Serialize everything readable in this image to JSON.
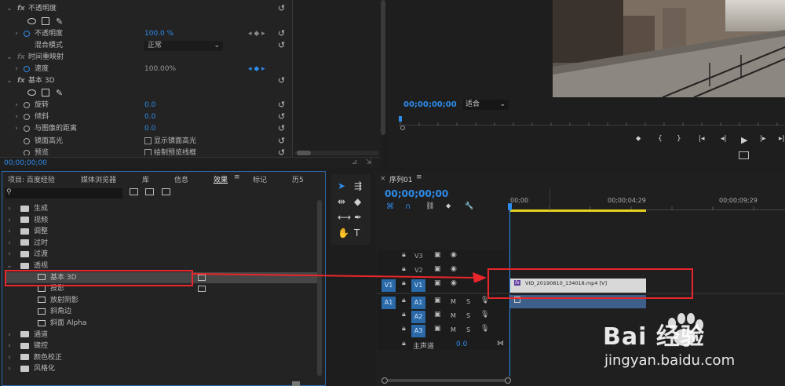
{
  "effect_controls": {
    "opacity_section": "不透明度",
    "opacity_label": "不透明度",
    "opacity_value": "100.0 %",
    "blend_label": "混合模式",
    "blend_value": "正常",
    "time_remap_section": "时间重映射",
    "speed_label": "速度",
    "speed_value": "100.00%",
    "basic3d_section": "基本 3D",
    "swivel_label": "旋转",
    "swivel_value": "0.0",
    "tilt_label": "倾斜",
    "tilt_value": "0.0",
    "distance_label": "与图像的距离",
    "distance_value": "0.0",
    "specular_label": "镜面高光",
    "specular_checkbox": "显示镜面高光",
    "preview_label": "预览",
    "preview_checkbox": "绘制预览线框",
    "timecode": "00;00;00;00",
    "fx_glyph": "fx"
  },
  "program_monitor": {
    "timecode": "00;00;00;00",
    "fit_value": "适合"
  },
  "project_panel": {
    "tabs": [
      "项目: 百度经验",
      "媒体浏览器",
      "库",
      "信息",
      "效果",
      "标记",
      "历5"
    ],
    "active_tab": "效果",
    "search_placeholder": "",
    "tree": [
      {
        "label": "生成",
        "type": "folder",
        "expanded": false
      },
      {
        "label": "视频",
        "type": "folder",
        "expanded": false
      },
      {
        "label": "调整",
        "type": "folder",
        "expanded": false
      },
      {
        "label": "过时",
        "type": "folder",
        "expanded": false
      },
      {
        "label": "过渡",
        "type": "folder",
        "expanded": false
      },
      {
        "label": "透视",
        "type": "folder",
        "expanded": true
      },
      {
        "label": "基本 3D",
        "type": "effect",
        "selected": true
      },
      {
        "label": "投影",
        "type": "effect"
      },
      {
        "label": "放射阴影",
        "type": "effect"
      },
      {
        "label": "斜角边",
        "type": "effect"
      },
      {
        "label": "斜面 Alpha",
        "type": "effect"
      },
      {
        "label": "通道",
        "type": "folder",
        "expanded": false
      },
      {
        "label": "键控",
        "type": "folder",
        "expanded": false
      },
      {
        "label": "颜色校正",
        "type": "folder",
        "expanded": false
      },
      {
        "label": "风格化",
        "type": "folder",
        "expanded": false
      }
    ]
  },
  "timeline": {
    "sequence_tab": "序列01",
    "timecode": "00;00;00;00",
    "ruler": [
      "00;00",
      "00;00;04;29",
      "00;00;09;29"
    ],
    "video_tracks": [
      "V3",
      "V2",
      "V1"
    ],
    "audio_tracks": [
      "A1",
      "A2",
      "A3"
    ],
    "source_v": "V1",
    "source_a": "A1",
    "mute": "M",
    "solo": "S",
    "master_label": "主声道",
    "master_value": "0.0",
    "clip_label": "VID_20190810_134018.mp4 [V]",
    "clip_fx": "fx"
  },
  "watermark": {
    "brand": "Bai 经验",
    "url": "jingyan.baidu.com"
  },
  "colors": {
    "accent_blue": "#2d8ceb",
    "annotation_red": "#e8262b",
    "clip_yellow": "#e6d020",
    "clip_audio": "#3e5f8a"
  }
}
